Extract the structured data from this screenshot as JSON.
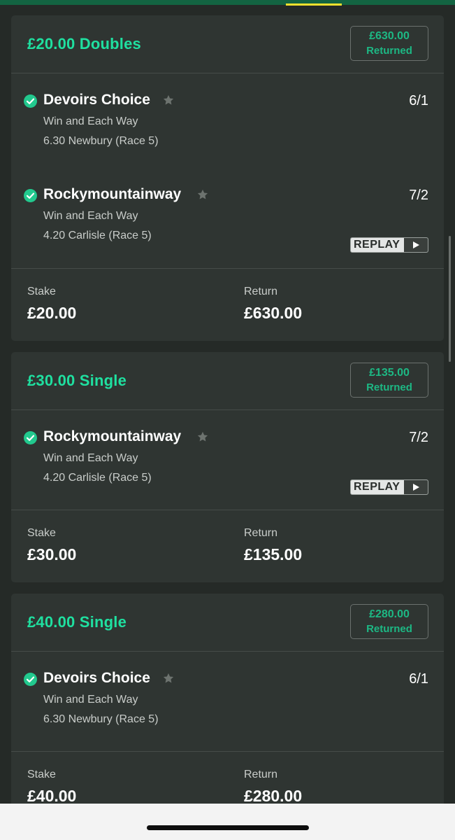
{
  "colors": {
    "background": "#252a27",
    "card": "#2f3532",
    "accent_green": "#1fe0a0",
    "returned_green": "#1db884",
    "check_green": "#22c98e",
    "topbar": "#136442",
    "active_tab_underline": "#f7e12e"
  },
  "icons": {
    "check": "check-circle-icon",
    "favourite": "star-icon",
    "replay": "play-icon"
  },
  "bets": [
    {
      "title": "£20.00 Doubles",
      "returned_amount": "£630.00",
      "returned_label": "Returned",
      "selections": [
        {
          "name": "Devoirs Choice",
          "market": "Win and Each Way",
          "event": "6.30 Newbury (Race 5)",
          "odds": "6/1"
        },
        {
          "name": "Rockymountainway",
          "market": "Win and Each Way",
          "event": "4.20 Carlisle (Race 5)",
          "odds": "7/2",
          "replay_label": "REPLAY"
        }
      ],
      "stake_label": "Stake",
      "stake": "£20.00",
      "return_label": "Return",
      "return": "£630.00"
    },
    {
      "title": "£30.00 Single",
      "returned_amount": "£135.00",
      "returned_label": "Returned",
      "selections": [
        {
          "name": "Rockymountainway",
          "market": "Win and Each Way",
          "event": "4.20 Carlisle (Race 5)",
          "odds": "7/2",
          "replay_label": "REPLAY"
        }
      ],
      "stake_label": "Stake",
      "stake": "£30.00",
      "return_label": "Return",
      "return": "£135.00"
    },
    {
      "title": "£40.00 Single",
      "returned_amount": "£280.00",
      "returned_label": "Returned",
      "selections": [
        {
          "name": "Devoirs Choice",
          "market": "Win and Each Way",
          "event": "6.30 Newbury (Race 5)",
          "odds": "6/1"
        }
      ],
      "stake_label": "Stake",
      "stake": "£40.00",
      "return_label": "Return",
      "return": "£280.00"
    }
  ]
}
